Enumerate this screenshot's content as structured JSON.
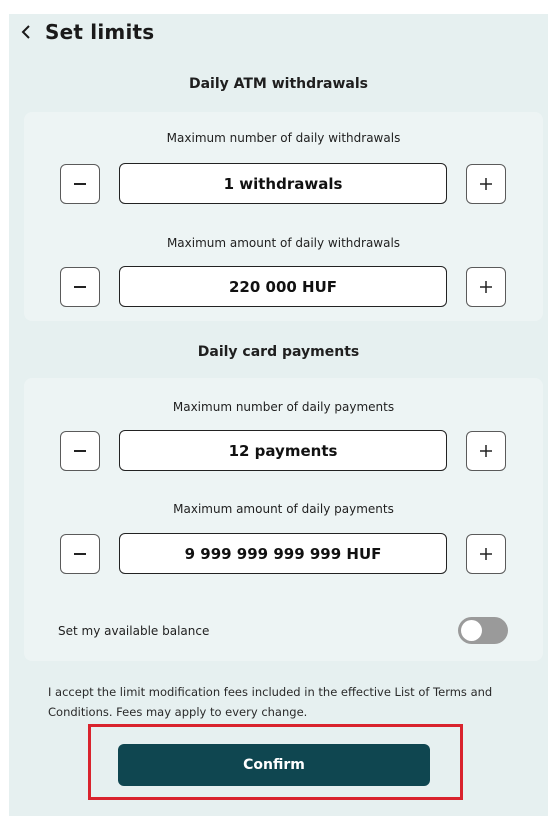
{
  "header": {
    "title": "Set limits",
    "back_icon": "chevron-left-icon"
  },
  "atm": {
    "section_title": "Daily ATM withdrawals",
    "count_label": "Maximum number of daily withdrawals",
    "count_value": "1 withdrawals",
    "amount_label": "Maximum amount of daily withdrawals",
    "amount_value": "220 000 HUF"
  },
  "card": {
    "section_title": "Daily card payments",
    "count_label": "Maximum number of daily payments",
    "count_value": "12 payments",
    "amount_label": "Maximum amount of daily payments",
    "amount_value": "9 999 999 999 999 HUF",
    "toggle_label": "Set my available balance",
    "toggle_on": false
  },
  "terms": "I accept the limit modification fees included in the effective List of Terms and Conditions. Fees may apply to every change.",
  "confirm_label": "Confirm",
  "colors": {
    "background": "#e6f0f0",
    "card": "#edf4f4",
    "primary": "#0f4650",
    "highlight": "#d9232d",
    "toggle_off": "#9a9a9a"
  },
  "icons": {
    "minus": "minus-icon",
    "plus": "plus-icon"
  }
}
